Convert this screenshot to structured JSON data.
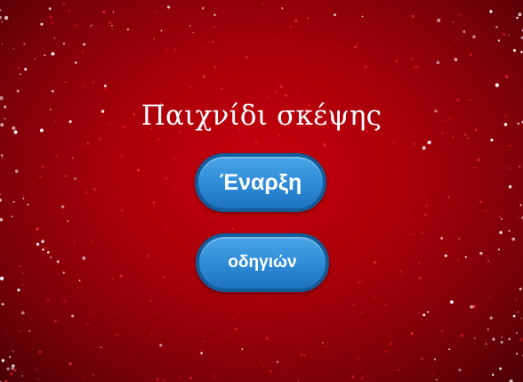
{
  "title": "Παιχνίδι σκέψης",
  "buttons": {
    "start_label": "Έναρξη",
    "help_label": "οδηγιών"
  },
  "colors": {
    "background": "#b0000a",
    "button_fill": "#2d8ad6",
    "button_border": "#135a98",
    "text": "#ffffff"
  }
}
